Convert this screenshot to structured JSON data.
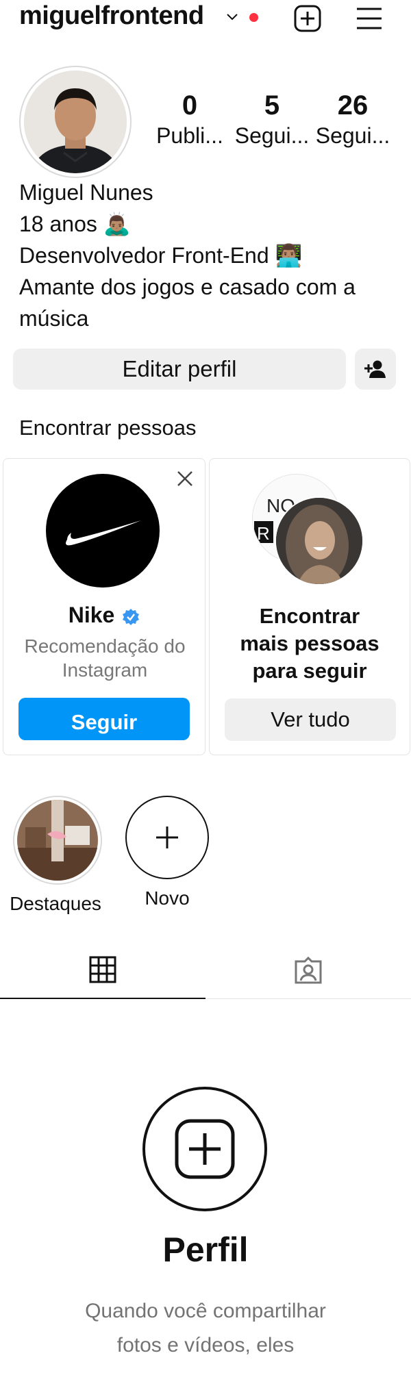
{
  "header": {
    "username": "miguelfrontend",
    "icons": [
      "chevron-down-icon",
      "notification-dot",
      "new-post-icon",
      "menu-icon"
    ],
    "dot_color": "#ff3040"
  },
  "profile": {
    "stats": [
      {
        "value": "0",
        "label": "Publi..."
      },
      {
        "value": "5",
        "label": "Segui..."
      },
      {
        "value": "26",
        "label": "Segui..."
      }
    ],
    "name": "Miguel Nunes",
    "bio_lines": [
      "18 anos 🙇🏽‍♂️",
      "Desenvolvedor Front-End 👨🏽‍💻",
      "Amante dos jogos e casado com a",
      "música"
    ],
    "edit_button": "Editar perfil"
  },
  "suggestions": {
    "title": "Encontrar pessoas",
    "cards": [
      {
        "name": "Nike",
        "verified": true,
        "subtitle": "Recomendação do Instagram",
        "button": "Seguir"
      },
      {
        "title": "Encontrar mais pessoas para seguir",
        "button": "Ver tudo"
      }
    ]
  },
  "highlights": [
    {
      "label": "Destaques"
    },
    {
      "label": "Novo"
    }
  ],
  "tabs": [
    "grid-icon",
    "tagged-icon"
  ],
  "empty_state": {
    "title": "Perfil",
    "description": "Quando você compartilhar fotos e vídeos, eles"
  },
  "colors": {
    "accent": "#0095f6",
    "button_bg": "#efefef",
    "muted_text": "#737373"
  }
}
